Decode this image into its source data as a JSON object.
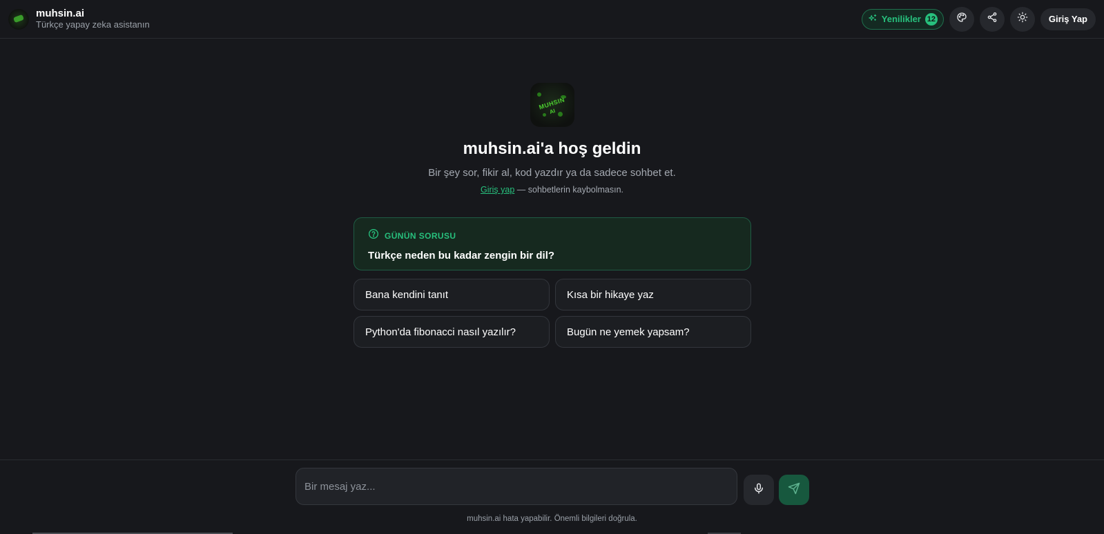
{
  "header": {
    "brand_title": "muhsin.ai",
    "brand_subtitle": "Türkçe yapay zeka asistanın",
    "news_label": "Yenilikler",
    "news_count": "12",
    "login_label": "Giriş Yap",
    "icons": [
      "sparkle-icon",
      "palette-icon",
      "share-icon",
      "sun-icon"
    ]
  },
  "hero": {
    "logo_text_1": "MUHSIN",
    "logo_text_2": "AI",
    "title": "muhsin.ai'a hoş geldin",
    "subtitle": "Bir şey sor, fikir al, kod yazdır ya da sadece sohbet et.",
    "login_link": "Giriş yap",
    "login_note": " — sohbetlerin kaybolmasın."
  },
  "question_of_day": {
    "label": "GÜNÜN SORUSU",
    "question": "Türkçe neden bu kadar zengin bir dil?"
  },
  "suggestions": [
    "Bana kendini tanıt",
    "Kısa bir hikaye yaz",
    "Python'da fibonacci nasıl yazılır?",
    "Bugün ne yemek yapsam?"
  ],
  "composer": {
    "placeholder": "Bir mesaj yaz..."
  },
  "footer": {
    "disclaimer": "muhsin.ai hata yapabilir. Önemli bilgileri doğrula."
  },
  "colors": {
    "background": "#17181c",
    "accent": "#27c07d",
    "send_button": "#17583e"
  }
}
